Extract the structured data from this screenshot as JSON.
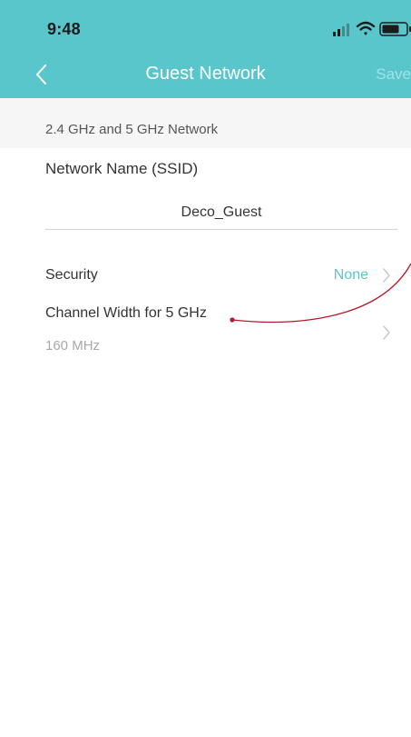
{
  "status_bar": {
    "time": "9:48",
    "icons": [
      "signal-icon",
      "wifi-icon",
      "battery-icon"
    ]
  },
  "header": {
    "title": "Guest Network",
    "save_label": "Save",
    "back_icon": "chevron-left-icon"
  },
  "section": {
    "label": "2.4 GHz and 5 GHz Network"
  },
  "ssid": {
    "label": "Network Name (SSID)",
    "value": "Deco_Guest"
  },
  "settings": {
    "security": {
      "label": "Security",
      "value": "None"
    },
    "channel_width": {
      "label": "Channel Width for 5 GHz",
      "value": "160 MHz"
    }
  },
  "colors": {
    "accent": "#59c6cc",
    "header_bg": "#59c6cc",
    "save_disabled": "#9fe3e6",
    "annotation": "#b01c2e",
    "section_bg": "#f6f6f6"
  }
}
